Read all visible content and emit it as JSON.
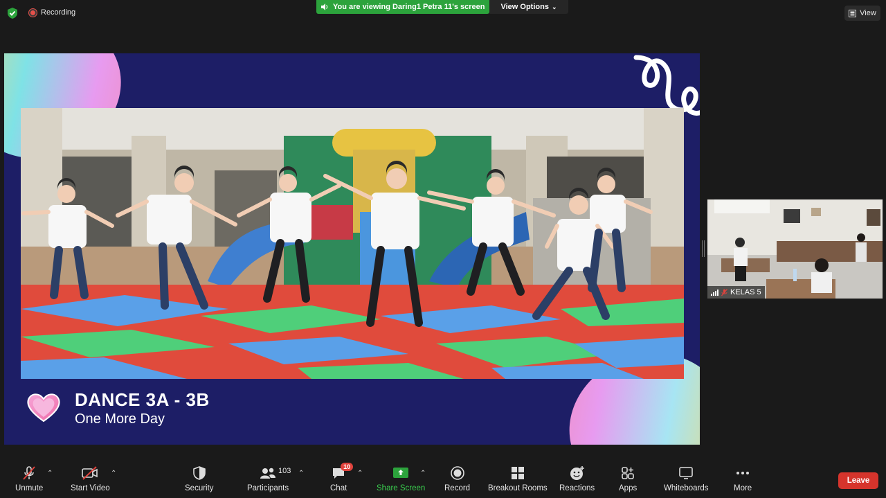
{
  "top": {
    "recording_label": "Recording",
    "viewing_banner": "You are viewing Daring1 Petra 11's screen",
    "view_options_label": "View Options",
    "view_label": "View"
  },
  "shared_screen": {
    "title": "DANCE 3A - 3B",
    "subtitle": "One More Day"
  },
  "participant": {
    "name": "KELAS 5"
  },
  "toolbar": {
    "unmute": "Unmute",
    "start_video": "Start Video",
    "security": "Security",
    "participants": "Participants",
    "participants_count": "103",
    "chat": "Chat",
    "chat_badge": "10",
    "share_screen": "Share Screen",
    "record": "Record",
    "breakout_rooms": "Breakout Rooms",
    "reactions": "Reactions",
    "apps": "Apps",
    "whiteboards": "Whiteboards",
    "more": "More",
    "leave": "Leave"
  },
  "colors": {
    "banner_green": "#2ca33c",
    "leave_red": "#d6342c",
    "share_green": "#3ad04f",
    "slide_navy": "#1d1e66"
  }
}
